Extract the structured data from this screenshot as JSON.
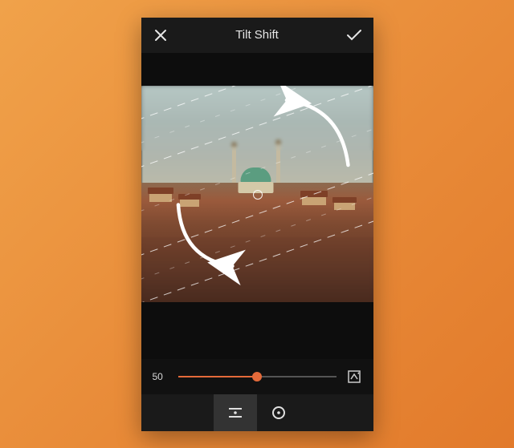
{
  "header": {
    "title": "Tilt Shift",
    "cancel_icon": "close-icon",
    "confirm_icon": "check-icon"
  },
  "slider": {
    "value": "50",
    "percent": 50
  },
  "controls": {
    "rotate_icon": "rotate-icon",
    "mode_linear_icon": "linear-mode-icon",
    "mode_radial_icon": "radial-mode-icon",
    "active_mode": "linear"
  },
  "overlay": {
    "gesture_hint_arrows": true,
    "focus_guides": true
  },
  "colors": {
    "accent": "#e46a3a",
    "bg": "#000000",
    "panel": "#1a1a1a"
  }
}
